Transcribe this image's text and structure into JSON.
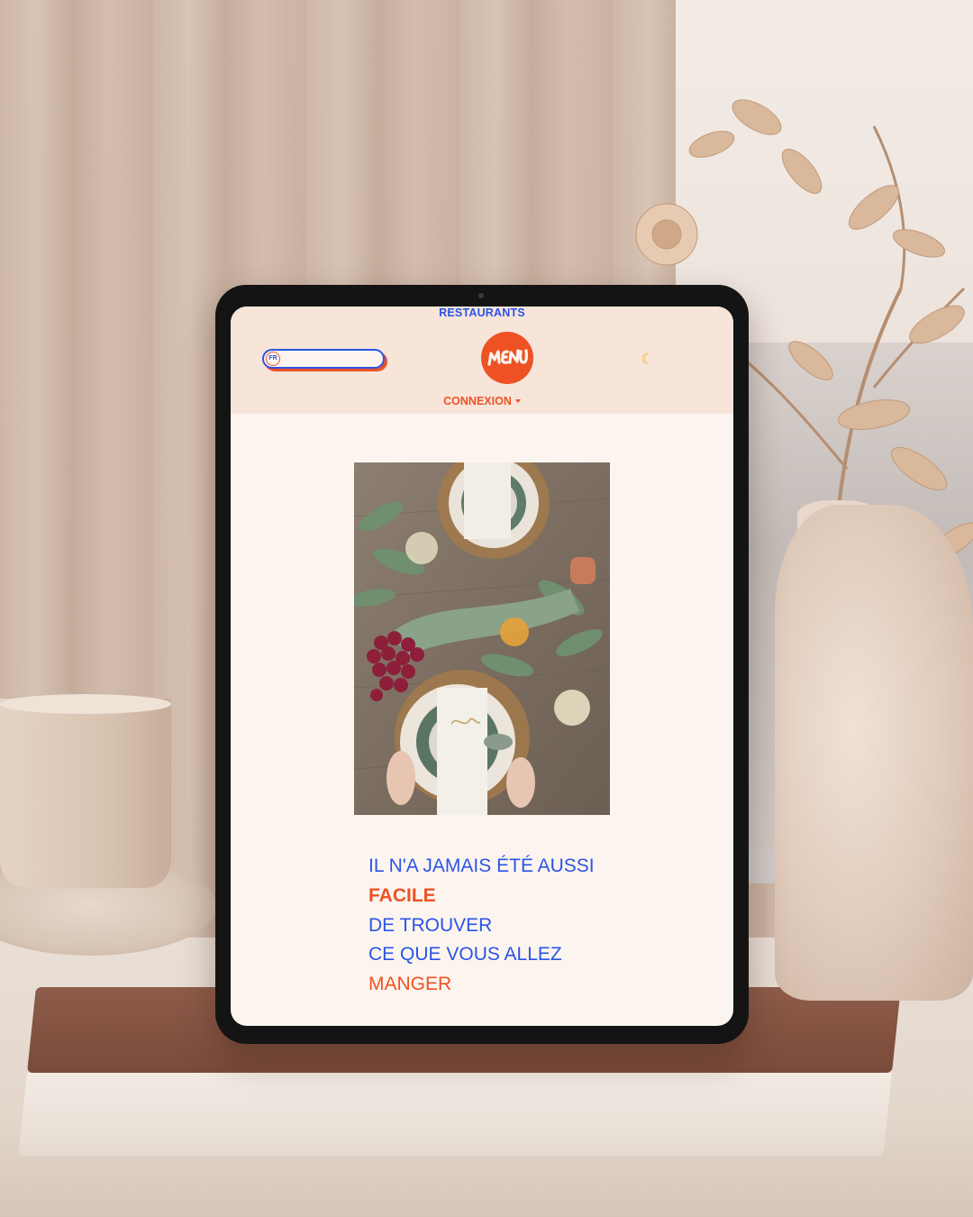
{
  "header": {
    "nav_link": "RESTAURANTS",
    "language_code": "FR",
    "logo_text": "MENU",
    "theme_icon": "moon-icon",
    "login_label": "CONNEXION"
  },
  "tagline": {
    "line1": "IL N'A JAMAIS ÉTÉ AUSSI",
    "line2": "FACILE",
    "line3": "DE TROUVER",
    "line4": "CE QUE VOUS ALLEZ",
    "line5": "MANGER"
  },
  "colors": {
    "brand_orange": "#ee5224",
    "brand_blue": "#2b54e6",
    "header_bg": "#f7e5da",
    "page_bg": "#fcf5ef"
  }
}
